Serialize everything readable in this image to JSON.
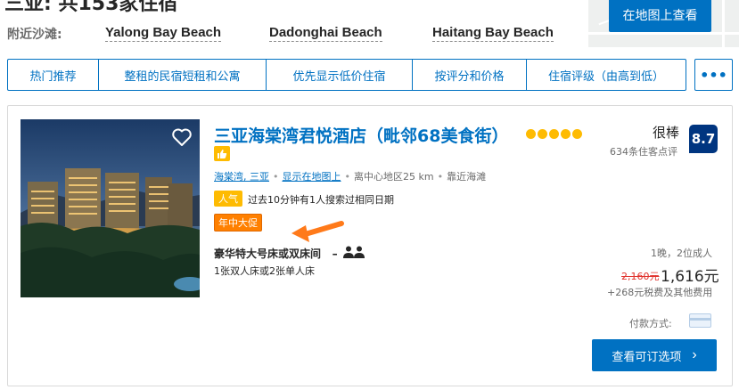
{
  "header": {
    "title": "三亚: 共153家住宿",
    "nearby_label": "附近沙滩:",
    "beaches": [
      "Yalong Bay Beach",
      "Dadonghai Beach",
      "Haitang Bay Beach"
    ],
    "map_button": "在地图上查看"
  },
  "sortbar": {
    "items": [
      "热门推荐",
      "整租的民宿短租和公寓",
      "优先显示低价住宿",
      "按评分和价格",
      "住宿评级（由高到低）"
    ],
    "more_label": "•••"
  },
  "hotel": {
    "name": "三亚海棠湾君悦酒店（毗邻68美食街）",
    "star_count": 5,
    "location_link": "海棠湾, 三亚",
    "map_link": "显示在地图上",
    "distance": "离中心地区25 km",
    "beach_note": "靠近海滩",
    "popular_badge": "人气",
    "popular_text": "过去10分钟有1人搜索过相同日期",
    "promo_badge": "年中大促",
    "room_name": "豪华特大号床或双床间",
    "room_dash": "–",
    "beds": "1张双人床或2张单人床",
    "review_word": "很棒",
    "review_count": "634条住客点评",
    "score": "8.7",
    "stay_info": "1晚，2位成人",
    "old_price": "2,160元",
    "price": "1,616元",
    "taxes": "+268元税费及其他费用",
    "pay_label": "付款方式:",
    "cta_label": "查看可订选项",
    "cta_arrow": "›"
  },
  "colors": {
    "brand_blue": "#0071c2",
    "dark_blue": "#003580",
    "star_yellow": "#febb02",
    "promo_orange": "#ff8000"
  }
}
